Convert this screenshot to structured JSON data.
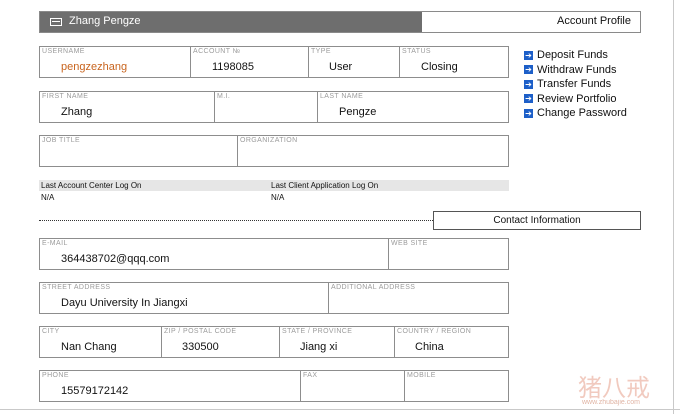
{
  "header": {
    "user_name": "Zhang Pengze",
    "section_title": "Account Profile"
  },
  "account": {
    "username_label": "USERNAME",
    "username": "pengzezhang",
    "account_no_label": "ACCOUNT №",
    "account_no": "1198085",
    "type_label": "TYPE",
    "type": "User",
    "status_label": "STATUS",
    "status": "Closing"
  },
  "name": {
    "first_label": "FIRST NAME",
    "first": "Zhang",
    "mi_label": "M.I.",
    "mi": "",
    "last_label": "LAST NAME",
    "last": "Pengze"
  },
  "job": {
    "title_label": "JOB TITLE",
    "title": "",
    "org_label": "ORGANIZATION",
    "org": ""
  },
  "logon": {
    "account_center_label": "Last Account Center Log On",
    "account_center_value": "N/A",
    "client_app_label": "Last Client Application Log On",
    "client_app_value": "N/A"
  },
  "actions": [
    {
      "label": "Deposit Funds",
      "icon": "arrow-right-icon"
    },
    {
      "label": "Withdraw Funds",
      "icon": "arrow-right-icon"
    },
    {
      "label": "Transfer Funds",
      "icon": "arrow-right-icon"
    },
    {
      "label": "Review Portfolio",
      "icon": "arrow-right-icon"
    },
    {
      "label": "Change Password",
      "icon": "arrow-right-icon"
    }
  ],
  "contact": {
    "button_label": "Contact Information",
    "email_label": "E-MAIL",
    "email": "364438702@qqq.com",
    "website_label": "WEB SITE",
    "website": "",
    "street_label": "STREET ADDRESS",
    "street": "Dayu University In Jiangxi",
    "additional_label": "ADDITIONAL ADDRESS",
    "additional": "",
    "city_label": "CITY",
    "city": "Nan Chang",
    "zip_label": "ZIP / POSTAL CODE",
    "zip": "330500",
    "state_label": "STATE / PROVINCE",
    "state": "Jiang xi",
    "country_label": "COUNTRY / REGION",
    "country": "China",
    "phone_label": "PHONE",
    "phone": "15579172142",
    "fax_label": "FAX",
    "fax": "",
    "mobile_label": "MOBILE",
    "mobile": ""
  },
  "watermark": {
    "chars": "猪八戒",
    "url": "www.zhubajie.com"
  },
  "colors": {
    "header_bg": "#6e6e6e",
    "link_icon": "#1d5fc8",
    "username_text": "#c8641e",
    "border": "#8d8d8d"
  }
}
